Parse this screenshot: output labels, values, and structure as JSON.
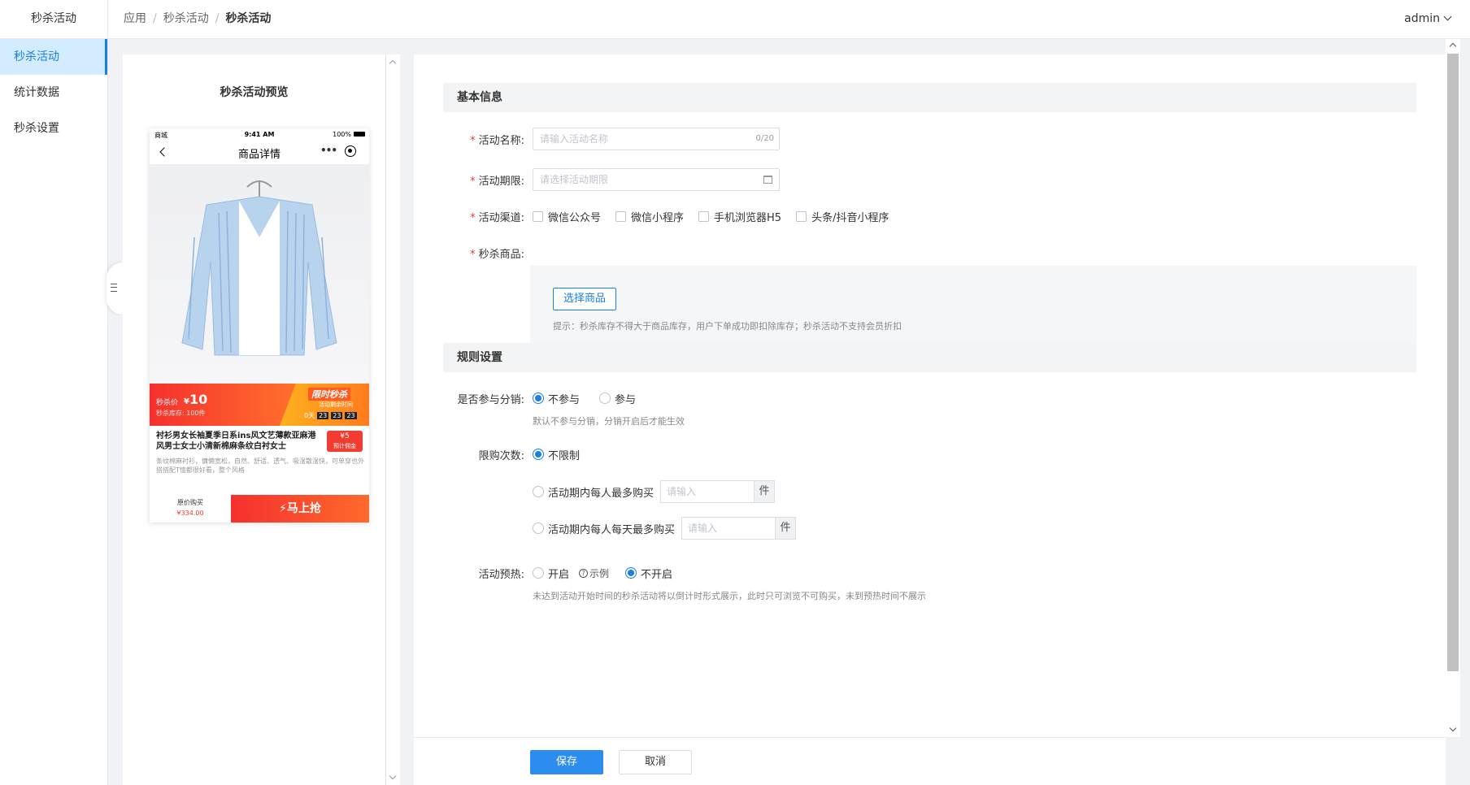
{
  "app": {
    "title": "秒杀活动"
  },
  "breadcrumb": [
    "应用",
    "秒杀活动",
    "秒杀活动"
  ],
  "user": {
    "name": "admin"
  },
  "sidebar": {
    "items": [
      {
        "label": "秒杀活动",
        "active": true
      },
      {
        "label": "统计数据",
        "active": false
      },
      {
        "label": "秒杀设置",
        "active": false
      }
    ]
  },
  "preview": {
    "title": "秒杀活动预览",
    "status": {
      "carrier": "商城",
      "time": "9:41 AM",
      "battery": "100%"
    },
    "nav_title": "商品详情",
    "price_label": "秒杀价",
    "price_symbol": "¥",
    "price": "10",
    "stock": "秒杀库存: 100件",
    "promo_tag": "限时秒杀",
    "countdown_label": "活动剩余时间",
    "countdown": {
      "days": "0天",
      "h": "23",
      "m": "23",
      "s": "23"
    },
    "product_name": "衬衫男女长袖夏季日系ins风文艺薄款亚麻港风男士女士小清新棉麻条纹白衬女士",
    "product_desc": "条纹棉麻衬衫，慵懒宽松，自然、舒适、透气、吸湿散湿快，可单穿也外搭搭配T恤都很好看，整个风格",
    "commission_value": "¥5",
    "commission_label": "预计佣金",
    "orig_buy_label": "原价购买",
    "orig_price": "¥334.00",
    "buy_now": "马上抢"
  },
  "form": {
    "section_basic": "基本信息",
    "name_label": "活动名称:",
    "name_placeholder": "请输入活动名称",
    "name_count": "0/20",
    "period_label": "活动期限:",
    "period_placeholder": "请选择活动期限",
    "channel_label": "活动渠道:",
    "channels": [
      "微信公众号",
      "微信小程序",
      "手机浏览器H5",
      "头条/抖音小程序"
    ],
    "goods_label": "秒杀商品:",
    "select_goods": "选择商品",
    "goods_tip": "提示：秒杀库存不得大于商品库存，用户下单成功即扣除库存；秒杀活动不支持会员折扣",
    "section_rules": "规则设置",
    "distribution_label": "是否参与分销:",
    "distribution_options": [
      "不参与",
      "参与"
    ],
    "distribution_selected": "不参与",
    "distribution_hint": "默认不参与分销，分销开启后才能生效",
    "limit_label": "限购次数:",
    "limit_options": [
      "不限制",
      "活动期内每人最多购买",
      "活动期内每人每天最多购买"
    ],
    "limit_selected": "不限制",
    "limit_placeholder": "请输入",
    "limit_unit": "件",
    "preheat_label": "活动预热:",
    "preheat_on": "开启",
    "preheat_example": "示例",
    "preheat_off": "不开启",
    "preheat_selected": "不开启",
    "preheat_hint": "未达到活动开始时间的秒杀活动将以倒计时形式展示，此时只可浏览不可购买，未到预热时间不展示"
  },
  "footer": {
    "save": "保存",
    "cancel": "取消"
  },
  "colors": {
    "accent": "#1a7fe0",
    "primary_button": "#2d8cf0",
    "danger": "#f23c2f"
  }
}
